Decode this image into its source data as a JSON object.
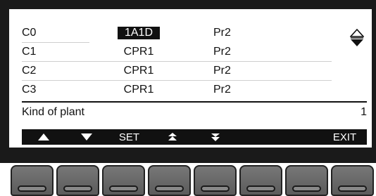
{
  "rows": [
    {
      "channel": "C0",
      "type": "1A1D",
      "program": "Pr2",
      "selected": true
    },
    {
      "channel": "C1",
      "type": "CPR1",
      "program": "Pr2",
      "selected": false
    },
    {
      "channel": "C2",
      "type": "CPR1",
      "program": "Pr2",
      "selected": false
    },
    {
      "channel": "C3",
      "type": "CPR1",
      "program": "Pr2",
      "selected": false
    }
  ],
  "parameter": {
    "label": "Kind of plant",
    "value": "1"
  },
  "function_keys": {
    "set_label": "SET",
    "exit_label": "EXIT"
  },
  "icons": {
    "scroll": "up-down-scroll-icon",
    "f1": "up-triangle-icon",
    "f2": "down-triangle-icon",
    "f4": "page-up-icon",
    "f5": "page-down-icon"
  },
  "colors": {
    "bezel": "#1a1a1a",
    "screen": "#ffffff",
    "softkey": "#666666",
    "selection": "#111111"
  }
}
